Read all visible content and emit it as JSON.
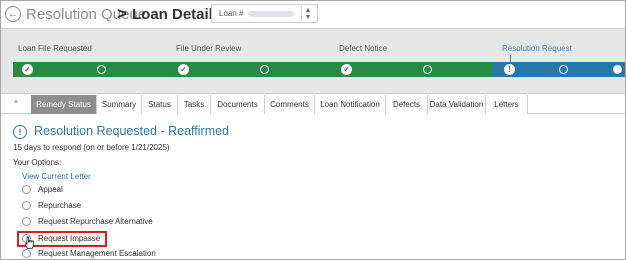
{
  "header": {
    "back_icon": "arrow-left-icon",
    "breadcrumb_parent": "Resolution Queue",
    "breadcrumb_separator": ">",
    "breadcrumb_current": "Loan Details",
    "loan_selector_label": "Loan #",
    "loan_selector_icon": "sort-arrows-icon"
  },
  "stepper": {
    "steps": [
      {
        "label": "Loan File Requested",
        "status": "complete"
      },
      {
        "label": "File Under Review",
        "status": "complete"
      },
      {
        "label": "Defect Notice",
        "status": "complete"
      },
      {
        "label": "Resolution Request",
        "status": "current"
      }
    ],
    "colors": {
      "complete": "#2a8a43",
      "current": "#2a77a6"
    }
  },
  "tabs": {
    "collapse_icon": "chevron-up-icon",
    "items": [
      "Remedy Status",
      "Summary",
      "Status",
      "Tasks",
      "Documents",
      "Comments",
      "Loan Notification",
      "Defects",
      "Data Validation",
      "Letters"
    ],
    "active": "Remedy Status"
  },
  "remedy": {
    "status_icon": "info-circle-icon",
    "status_title": "Resolution Requested - Reaffirmed",
    "deadline": "15 days to respond (on or before 1/21/2025)",
    "options_heading": "Your Options:",
    "view_letter_link": "View Current Letter",
    "options": [
      "Appeal",
      "Repurchase",
      "Request Repurchase Alternative",
      "Request Impasse",
      "Request Management Escalation"
    ],
    "highlighted_option": "Request Impasse",
    "highlight_color": "#d71f26",
    "accent_color": "#2f76a8"
  }
}
